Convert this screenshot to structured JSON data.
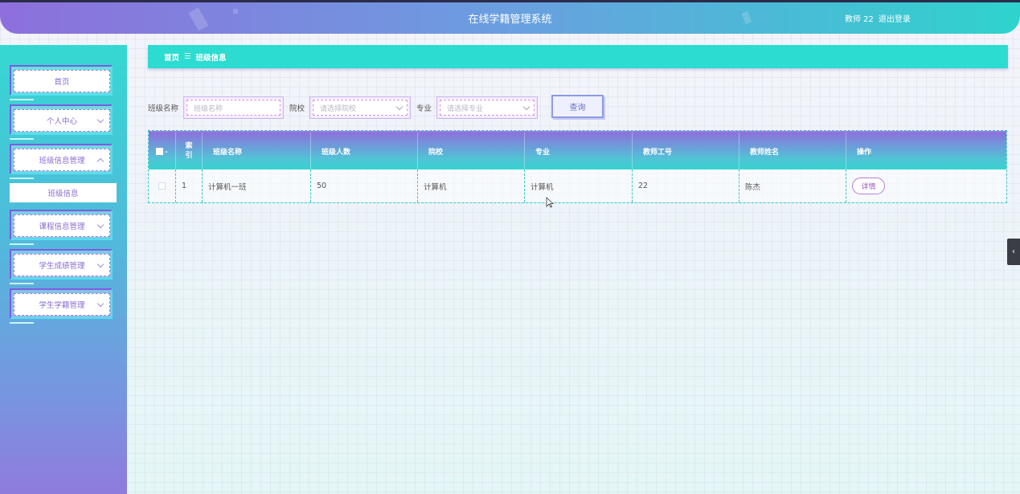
{
  "app": {
    "title": "在线学籍管理系统",
    "user_label": "教师 22",
    "logout_label": "退出登录"
  },
  "sidebar": {
    "items": [
      {
        "label": "首页",
        "has_arrow": false
      },
      {
        "label": "个人中心",
        "has_arrow": true
      },
      {
        "label": "班级信息管理",
        "has_arrow": true,
        "expanded": true
      },
      {
        "label": "课程信息管理",
        "has_arrow": true
      },
      {
        "label": "学生成绩管理",
        "has_arrow": true
      },
      {
        "label": "学生学籍管理",
        "has_arrow": true
      }
    ],
    "submenu": {
      "label": "班级信息"
    }
  },
  "breadcrumb": {
    "home": "首页",
    "separator": "☰",
    "current": "班级信息"
  },
  "search": {
    "class_name_label": "班级名称",
    "class_name_placeholder": "班级名称",
    "school_label": "院校",
    "school_placeholder": "请选择院校",
    "major_label": "专业",
    "major_placeholder": "请选择专业",
    "query_button": "查询"
  },
  "table": {
    "headers": [
      "索引",
      "班级名称",
      "班级人数",
      "院校",
      "专业",
      "教师工号",
      "教师姓名",
      "操作"
    ],
    "index_header_line1": "索",
    "index_header_line2": "引",
    "rows": [
      {
        "index": "1",
        "class_name": "计算机一班",
        "count": "50",
        "school": "计算机",
        "major": "计算机",
        "teacher_id": "22",
        "teacher_name": "陈杰",
        "action": "详情"
      }
    ]
  },
  "colors": {
    "accent_teal": "#2ddcd0",
    "accent_purple": "#8a72dc"
  }
}
